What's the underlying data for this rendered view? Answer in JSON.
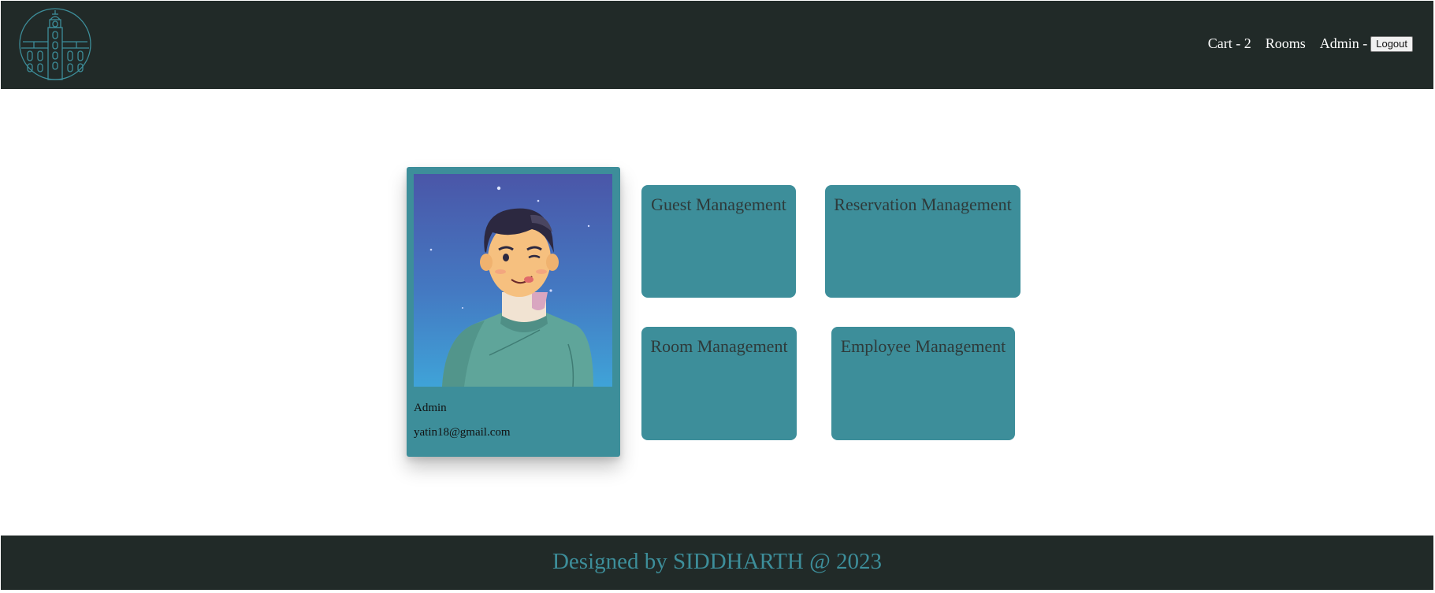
{
  "header": {
    "logo_icon": "building-tower-icon",
    "nav": {
      "cart_label": "Cart - 2",
      "rooms_label": "Rooms",
      "admin_label": "Admin -",
      "logout_label": "Logout"
    }
  },
  "profile": {
    "avatar_icon": "admin-avatar-illustration",
    "name": "Admin",
    "email": "yatin18@gmail.com"
  },
  "tiles": [
    {
      "label": "Guest Management"
    },
    {
      "label": "Reservation Management"
    },
    {
      "label": "Room Management"
    },
    {
      "label": "Employee Management"
    }
  ],
  "footer": {
    "text": "Designed by SIDDHARTH @ 2023"
  },
  "colors": {
    "header_bg": "#212a28",
    "accent": "#3d8e9a",
    "page_bg": "#ffffff"
  }
}
